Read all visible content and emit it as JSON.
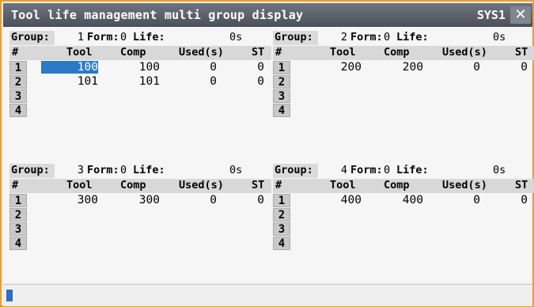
{
  "window": {
    "title": "Tool life management multi group display",
    "system": "SYS1",
    "close_icon": "close-icon"
  },
  "labels": {
    "group": "Group:",
    "form": "Form:",
    "life": "Life:"
  },
  "columns": {
    "num": "#",
    "tool": "Tool",
    "comp": "Comp",
    "used": "Used(s)",
    "st": "ST"
  },
  "groups": [
    {
      "number": "1",
      "form": "0",
      "life": "0s",
      "rows": [
        {
          "idx": "1",
          "tool": "100",
          "comp": "100",
          "used": "0",
          "st": "0"
        },
        {
          "idx": "2",
          "tool": "101",
          "comp": "101",
          "used": "0",
          "st": "0"
        },
        {
          "idx": "3",
          "tool": "",
          "comp": "",
          "used": "",
          "st": ""
        },
        {
          "idx": "4",
          "tool": "",
          "comp": "",
          "used": "",
          "st": ""
        }
      ]
    },
    {
      "number": "2",
      "form": "0",
      "life": "0s",
      "rows": [
        {
          "idx": "1",
          "tool": "200",
          "comp": "200",
          "used": "0",
          "st": "0"
        },
        {
          "idx": "2",
          "tool": "",
          "comp": "",
          "used": "",
          "st": ""
        },
        {
          "idx": "3",
          "tool": "",
          "comp": "",
          "used": "",
          "st": ""
        },
        {
          "idx": "4",
          "tool": "",
          "comp": "",
          "used": "",
          "st": ""
        }
      ]
    },
    {
      "number": "3",
      "form": "0",
      "life": "0s",
      "rows": [
        {
          "idx": "1",
          "tool": "300",
          "comp": "300",
          "used": "0",
          "st": "0"
        },
        {
          "idx": "2",
          "tool": "",
          "comp": "",
          "used": "",
          "st": ""
        },
        {
          "idx": "3",
          "tool": "",
          "comp": "",
          "used": "",
          "st": ""
        },
        {
          "idx": "4",
          "tool": "",
          "comp": "",
          "used": "",
          "st": ""
        }
      ]
    },
    {
      "number": "4",
      "form": "0",
      "life": "0s",
      "rows": [
        {
          "idx": "1",
          "tool": "400",
          "comp": "400",
          "used": "0",
          "st": "0"
        },
        {
          "idx": "2",
          "tool": "",
          "comp": "",
          "used": "",
          "st": ""
        },
        {
          "idx": "3",
          "tool": "",
          "comp": "",
          "used": "",
          "st": ""
        },
        {
          "idx": "4",
          "tool": "",
          "comp": "",
          "used": "",
          "st": ""
        }
      ]
    }
  ],
  "input": {
    "value": ""
  },
  "colors": {
    "accent": "#e8a030",
    "selection": "#2b7ac7",
    "titlebar": "#4a5058"
  }
}
